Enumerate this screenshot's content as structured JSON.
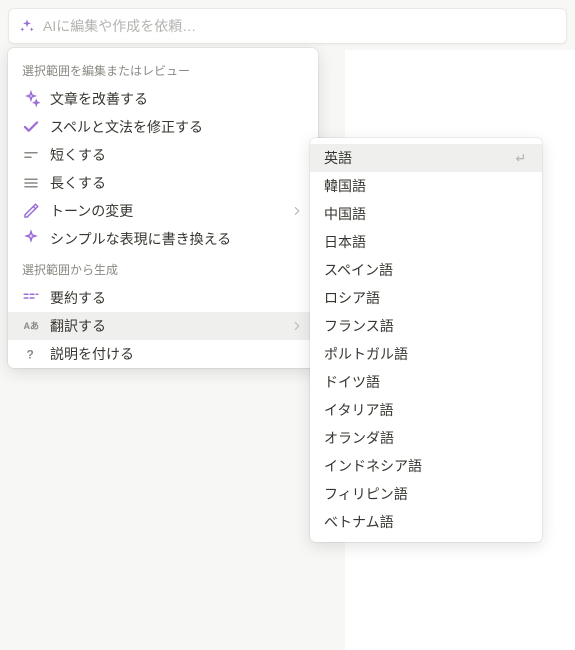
{
  "input": {
    "placeholder": "AIに編集や作成を依頼…"
  },
  "panel": {
    "sections": [
      {
        "header": "選択範囲を編集またはレビュー",
        "items": [
          {
            "icon": "sparkle",
            "label": "文章を改善する",
            "hasSub": false
          },
          {
            "icon": "check",
            "label": "スペルと文法を修正する",
            "hasSub": false
          },
          {
            "icon": "short",
            "label": "短くする",
            "hasSub": false
          },
          {
            "icon": "long",
            "label": "長くする",
            "hasSub": false
          },
          {
            "icon": "mic",
            "label": "トーンの変更",
            "hasSub": true
          },
          {
            "icon": "simplify",
            "label": "シンプルな表現に書き換える",
            "hasSub": false
          }
        ]
      },
      {
        "header": "選択範囲から生成",
        "items": [
          {
            "icon": "summary",
            "label": "要約する",
            "hasSub": false
          },
          {
            "icon": "translate",
            "label": "翻訳する",
            "hasSub": true,
            "hovered": true
          },
          {
            "icon": "question",
            "label": "説明を付ける",
            "hasSub": false
          }
        ]
      }
    ]
  },
  "submenu": {
    "items": [
      {
        "label": "英語",
        "hovered": true
      },
      {
        "label": "韓国語"
      },
      {
        "label": "中国語"
      },
      {
        "label": "日本語"
      },
      {
        "label": "スペイン語"
      },
      {
        "label": "ロシア語"
      },
      {
        "label": "フランス語"
      },
      {
        "label": "ポルトガル語"
      },
      {
        "label": "ドイツ語"
      },
      {
        "label": "イタリア語"
      },
      {
        "label": "オランダ語"
      },
      {
        "label": "インドネシア語"
      },
      {
        "label": "フィリピン語"
      },
      {
        "label": "ベトナム語"
      }
    ]
  }
}
